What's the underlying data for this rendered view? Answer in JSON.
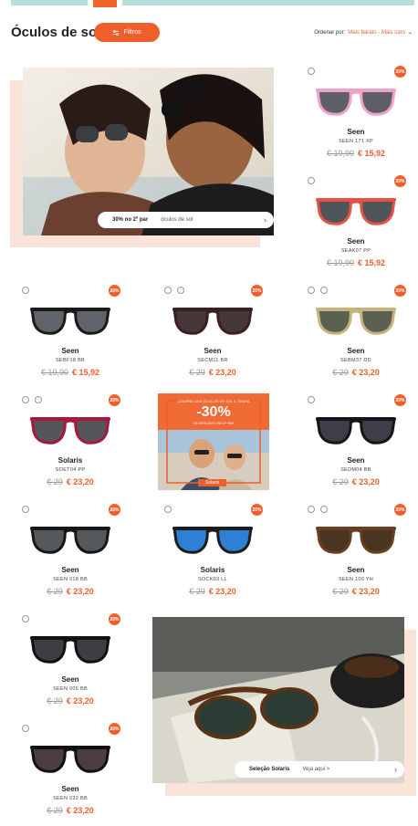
{
  "page": {
    "title": "Óculos de sol",
    "filter_label": "Filtros",
    "sort_label": "Ordenar por:",
    "sort_value": "Mais barato - Mais caro"
  },
  "colors": {
    "accent": "#ee5f2b",
    "promo_bg": "#fae3d9",
    "link": "#2b5fb0"
  },
  "hero_top": {
    "label_bold": "30% no 2º par",
    "label_light": "óculos de sol"
  },
  "hero_bottom": {
    "label_bold": "Seleção Solaris",
    "label_light": "Veja aqui >"
  },
  "promo": {
    "top_text": "COMPRE UNS ÓCULOS DE SOL E TENHA",
    "pct": "-30%",
    "sub_text": "DE DESCONTO NO 2º PAR",
    "btn": "Solaris"
  },
  "products": [
    {
      "brand": "Seen",
      "model": "SEEN 171 XP",
      "old": "19,90",
      "new": "€ 15,92",
      "badge": "20%",
      "icons": 1,
      "lens": "#5d6066",
      "frame": "#f2a0c8"
    },
    {
      "brand": "Seen",
      "model": "SEAK07 PP",
      "old": "19,90",
      "new": "€ 15,92",
      "badge": "20%",
      "icons": 1,
      "lens": "#4f555a",
      "frame": "#e8503f"
    },
    {
      "brand": "Seen",
      "model": "SEBF18 BB",
      "old": "19,90",
      "new": "€ 15,92",
      "badge": "20%",
      "icons": 1,
      "lens": "#60646a",
      "frame": "#1a1a1a"
    },
    {
      "brand": "Seen",
      "model": "SECM11 BR",
      "old": "29",
      "new": "€ 23,20",
      "badge": "20%",
      "icons": 2,
      "lens": "#45373a",
      "frame": "#3a2020"
    },
    {
      "brand": "Seen",
      "model": "SEBM37 DD",
      "old": "29",
      "new": "€ 23,20",
      "badge": "20%",
      "icons": 2,
      "lens": "#5a6150",
      "frame": "#c8b27a"
    },
    {
      "brand": "Solaris",
      "model": "SOET04 PP",
      "old": "29",
      "new": "€ 23,20",
      "badge": "20%",
      "icons": 2,
      "lens": "#55565a",
      "frame": "#a8183a"
    },
    {
      "brand": "Seen",
      "model": "SEDM04 BB",
      "old": "29",
      "new": "€ 23,20",
      "badge": "20%",
      "icons": 1,
      "lens": "#3f3d4a",
      "frame": "#151515"
    },
    {
      "brand": "Seen",
      "model": "SEEN 018 BB",
      "old": "29",
      "new": "€ 23,20",
      "badge": "20%",
      "icons": 1,
      "lens": "#56595c",
      "frame": "#161616"
    },
    {
      "brand": "Solaris",
      "model": "SOCK03 LL",
      "old": "29",
      "new": "€ 23,20",
      "badge": "20%",
      "icons": 1,
      "lens": "#2e7fd6",
      "frame": "#1c1c1c"
    },
    {
      "brand": "Seen",
      "model": "SEEN 100 YH",
      "old": "29",
      "new": "€ 23,20",
      "badge": "20%",
      "icons": 2,
      "lens": "#4a3520",
      "frame": "#6a3f1f"
    },
    {
      "brand": "Seen",
      "model": "SEEN 005 BB",
      "old": "29",
      "new": "€ 23,20",
      "badge": "20%",
      "icons": 1,
      "lens": "#3d3e42",
      "frame": "#111111"
    },
    {
      "brand": "Seen",
      "model": "SEEN 022 BB",
      "old": "29",
      "new": "€ 23,20",
      "badge": "20%",
      "icons": 1,
      "lens": "#4a3e44",
      "frame": "#111111"
    }
  ]
}
